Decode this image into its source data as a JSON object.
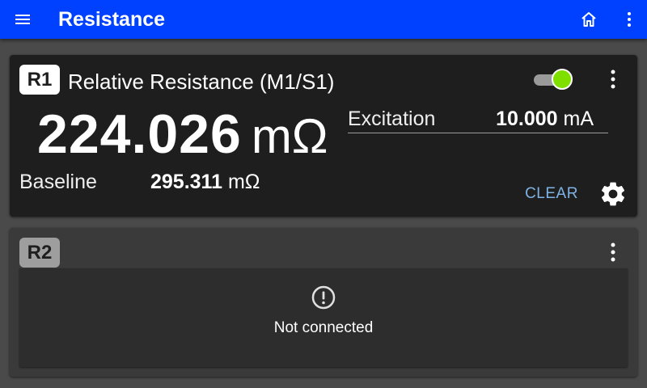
{
  "app": {
    "title": "Resistance",
    "accent_color": "#0040ff",
    "icons": {
      "menu": "menu-icon",
      "home": "home-icon",
      "more": "more-vert-icon"
    }
  },
  "channels": [
    {
      "badge": "R1",
      "title": "Relative Resistance (M1/S1)",
      "enabled": true,
      "toggle_color": "#7fe000",
      "reading": {
        "value": "224.026",
        "unit": "mΩ"
      },
      "excitation": {
        "label": "Excitation",
        "value": "10.000",
        "unit": "mA"
      },
      "baseline": {
        "label": "Baseline",
        "value": "295.311",
        "unit": "mΩ"
      },
      "clear_label": "CLEAR",
      "settings_icon": "gear-icon"
    },
    {
      "badge": "R2",
      "status_text": "Not connected",
      "status_icon": "alert-circle-icon"
    }
  ]
}
